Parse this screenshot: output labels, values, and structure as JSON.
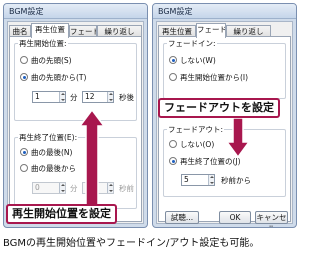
{
  "left_window": {
    "title": "BGM設定",
    "tabs": [
      "曲名",
      "再生位置",
      "フェード",
      "繰り返し"
    ],
    "group1": {
      "legend": "再生開始位置:",
      "opt_start": "曲の先頭(S)",
      "opt_from": "曲の先頭から(T)",
      "minutes_value": "1",
      "minutes_unit": "分",
      "seconds_value": "12",
      "seconds_unit": "秒後"
    },
    "group2": {
      "legend": "再生終了位置(E):",
      "opt_end": "曲の最後(N)",
      "opt_from_end": "曲の最後から",
      "minutes_value": "0",
      "minutes_unit": "分",
      "seconds_value": "0",
      "seconds_unit": "秒前"
    },
    "callout": "再生開始位置を設定"
  },
  "right_window": {
    "title": "BGM設定",
    "tabs": [
      "再生位置",
      "フェード",
      "繰り返し"
    ],
    "fade_in": {
      "legend": "フェードイン:",
      "opt_none": "しない(W)",
      "opt_from_start": "再生開始位置から(I)"
    },
    "fade_out": {
      "legend": "フェードアウト:",
      "opt_none": "しない(O)",
      "opt_from_end": "再生終了位置の(J)",
      "seconds_value": "5",
      "seconds_unit": "秒前から"
    },
    "buttons": {
      "test": "試聴...",
      "ok": "OK",
      "cancel": "キャンセル"
    },
    "callout": "フェードアウトを設定"
  },
  "caption": "BGMの再生開始位置やフェードイン/アウト設定も可能。",
  "colors": {
    "arrow": "#a8174e",
    "callout_border": "#a8174e",
    "window_frame": "#cfdbea"
  }
}
